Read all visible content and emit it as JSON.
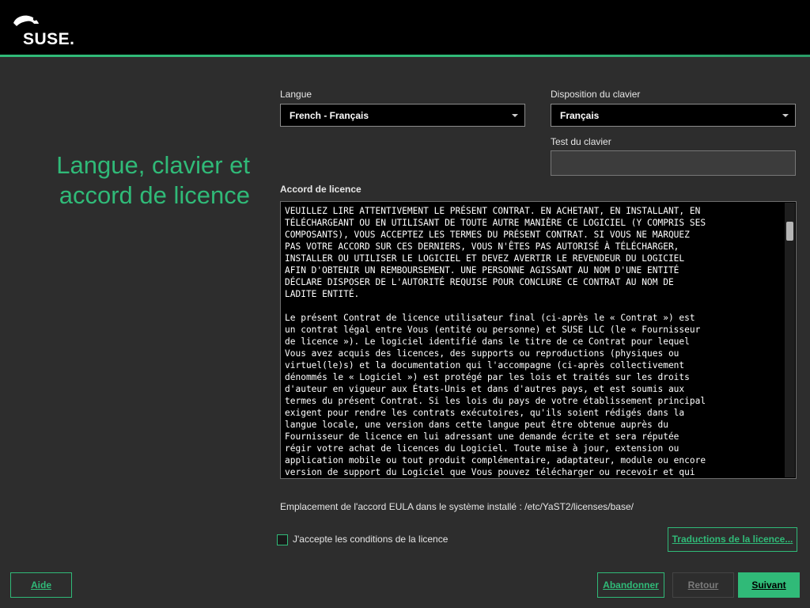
{
  "header": {
    "logo_text": "SUSE."
  },
  "title": "Langue, clavier et accord de licence",
  "language": {
    "label": "Langue",
    "value": "French - Français"
  },
  "keyboard": {
    "label": "Disposition du clavier",
    "value": "Français"
  },
  "keyboard_test": {
    "label": "Test du clavier",
    "value": ""
  },
  "license": {
    "label": "Accord de licence",
    "text": "VEUILLEZ LIRE ATTENTIVEMENT LE PRÉSENT CONTRAT. EN ACHETANT, EN INSTALLANT, EN\nTÉLÉCHARGEANT OU EN UTILISANT DE TOUTE AUTRE MANIÈRE CE LOGICIEL (Y COMPRIS SES\nCOMPOSANTS), VOUS ACCEPTEZ LES TERMES DU PRÉSENT CONTRAT. SI VOUS NE MARQUEZ\nPAS VOTRE ACCORD SUR CES DERNIERS, VOUS N'ÊTES PAS AUTORISÉ À TÉLÉCHARGER,\nINSTALLER OU UTILISER LE LOGICIEL ET DEVEZ AVERTIR LE REVENDEUR DU LOGICIEL\nAFIN D'OBTENIR UN REMBOURSEMENT. UNE PERSONNE AGISSANT AU NOM D'UNE ENTITÉ\nDÉCLARE DISPOSER DE L'AUTORITÉ REQUISE POUR CONCLURE CE CONTRAT AU NOM DE\nLADITE ENTITÉ.\n\nLe présent Contrat de licence utilisateur final (ci-après le « Contrat ») est\nun contrat légal entre Vous (entité ou personne) et SUSE LLC (le « Fournisseur\nde licence »). Le logiciel identifié dans le titre de ce Contrat pour lequel\nVous avez acquis des licences, des supports ou reproductions (physiques ou\nvirtuel(le)s) et la documentation qui l'accompagne (ci-après collectivement\ndénommés le « Logiciel ») est protégé par les lois et traités sur les droits\nd'auteur en vigueur aux États-Unis et dans d'autres pays, et est soumis aux\ntermes du présent Contrat. Si les lois du pays de votre établissement principal\nexigent pour rendre les contrats exécutoires, qu'ils soient rédigés dans la\nlangue locale, une version dans cette langue peut être obtenue auprès du\nFournisseur de licence en lui adressant une demande écrite et sera réputée\nrégir votre achat de licences du Logiciel. Toute mise à jour, extension ou\napplication mobile ou tout produit complémentaire, adaptateur, module ou encore\nversion de support du Logiciel que Vous pouvez télécharger ou recevoir et qui"
  },
  "eula_location": "Emplacement de l'accord EULA dans le système installé : /etc/YaST2/licenses/base/",
  "accept": {
    "label": "J'accepte les conditions de la licence",
    "checked": false
  },
  "buttons": {
    "translations": "Traductions de la licence...",
    "help": "Aide",
    "abort": "Abandonner",
    "back": "Retour",
    "next": "Suivant"
  },
  "colors": {
    "accent": "#30ba78",
    "header_bg": "#000000",
    "page_bg": "#2d2d2d"
  }
}
